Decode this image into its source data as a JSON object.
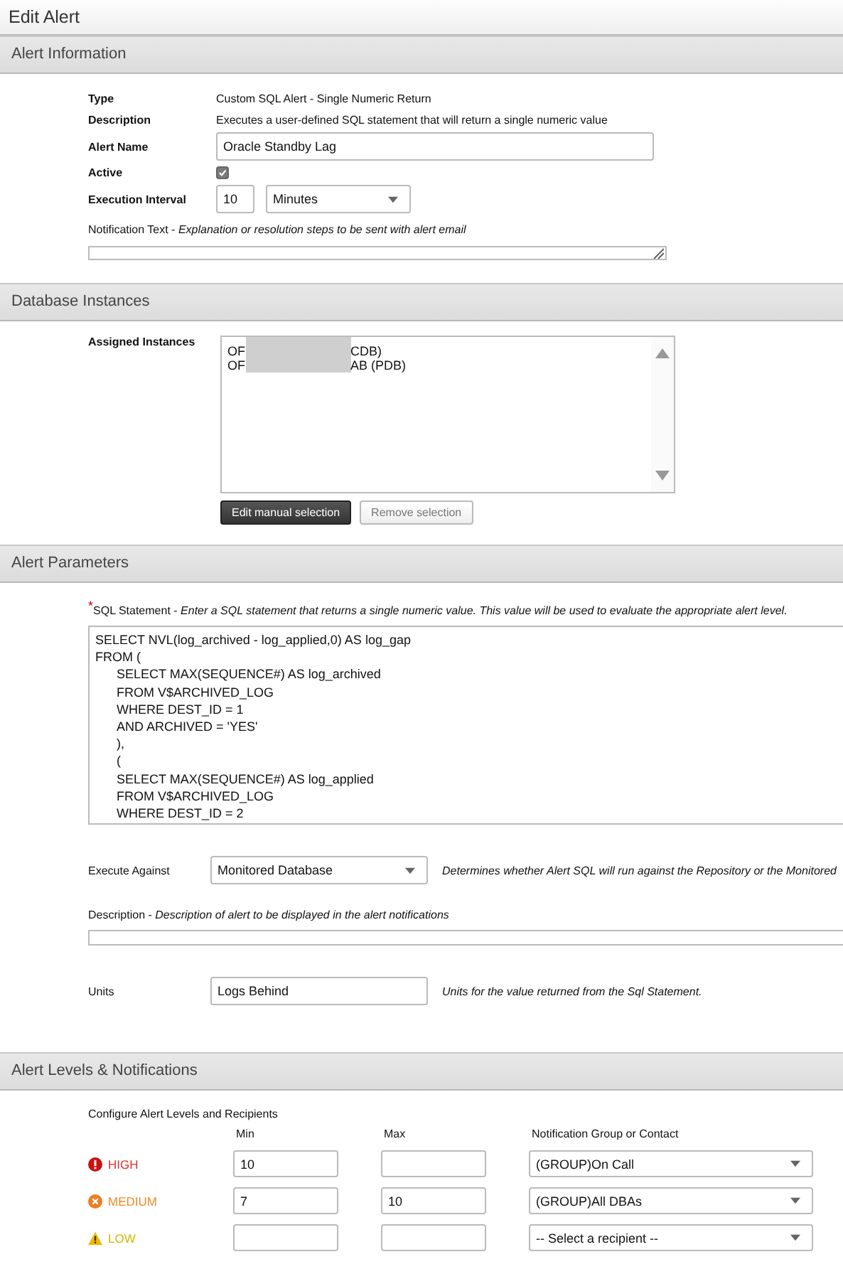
{
  "page_title": "Edit Alert",
  "alert_information": {
    "heading": "Alert Information",
    "type_label": "Type",
    "type_value": "Custom SQL Alert - Single Numeric Return",
    "description_label": "Description",
    "description_value": "Executes a user-defined SQL statement that will return a single numeric value",
    "name_label": "Alert Name",
    "name_value": "Oracle Standby Lag",
    "active_label": "Active",
    "active": true,
    "interval_label": "Execution Interval",
    "interval_value": "10",
    "interval_unit": "Minutes",
    "notification_label": "Notification Text -",
    "notification_hint": "Explanation or resolution steps to be sent with alert email"
  },
  "database_instances": {
    "heading": "Database Instances",
    "assigned_label": "Assigned Instances",
    "instances": [
      {
        "prefix": "OF",
        "suffix": "CDB)"
      },
      {
        "prefix": "OF",
        "suffix": "AB (PDB)"
      }
    ],
    "buttons": [
      {
        "label": "Edit manual selection",
        "kind": "primary"
      },
      {
        "label": "Remove selection",
        "kind": "secondary"
      }
    ]
  },
  "alert_parameters": {
    "heading": "Alert Parameters",
    "required_mark": "*",
    "sql_label": "SQL Statement -",
    "sql_hint": "Enter a SQL statement that returns a single numeric value. This value will be used to evaluate the appropriate alert level.",
    "sql_lines": [
      {
        "text": "SELECT NVL(log_archived - log_applied,0) AS log_gap",
        "indented": false
      },
      {
        "text": "FROM (",
        "indented": false
      },
      {
        "text": "SELECT MAX(SEQUENCE#) AS log_archived",
        "indented": true
      },
      {
        "text": "FROM V$ARCHIVED_LOG",
        "indented": true
      },
      {
        "text": "WHERE DEST_ID = 1",
        "indented": true
      },
      {
        "text": "AND ARCHIVED = 'YES'",
        "indented": true
      },
      {
        "text": "),",
        "indented": true
      },
      {
        "text": "(",
        "indented": true
      },
      {
        "text": "SELECT MAX(SEQUENCE#) AS log_applied",
        "indented": true
      },
      {
        "text": "FROM V$ARCHIVED_LOG",
        "indented": true
      },
      {
        "text": "WHERE DEST_ID = 2",
        "indented": true
      }
    ],
    "execute_label": "Execute Against",
    "execute_value": "Monitored Database",
    "execute_help": "Determines whether Alert SQL will run against the Repository or the Monitored",
    "description_label": "Description -",
    "description_hint": "Description of alert to be displayed in the alert notifications",
    "units_label": "Units",
    "units_value": "Logs Behind",
    "units_help": "Units for the value returned from the Sql Statement."
  },
  "alert_levels": {
    "heading": "Alert Levels & Notifications",
    "intro": "Configure Alert Levels and Recipients",
    "columns": [
      "Min",
      "Max",
      "Notification Group or Contact"
    ],
    "levels": [
      {
        "kind": "high",
        "label": "HIGH",
        "min": "10",
        "recipient": "(GROUP)On Call"
      },
      {
        "kind": "medium",
        "label": "MEDIUM",
        "min": "7",
        "max": "10",
        "recipient": "(GROUP)All DBAs"
      },
      {
        "kind": "low",
        "label": "LOW",
        "recipient": "-- Select a recipient --"
      }
    ]
  }
}
